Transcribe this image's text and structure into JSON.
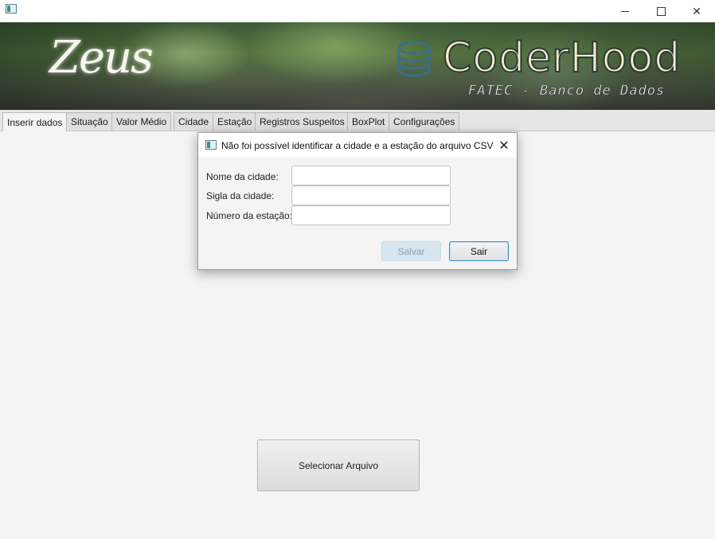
{
  "window": {
    "minimize_label": "—",
    "maximize_label": "☐",
    "close_label": "✕"
  },
  "banner": {
    "left_logo_text": "Zeus",
    "brand_name": "CoderHood",
    "brand_subtitle": "FATEC - Banco de Dados",
    "brand_icon": "database-icon"
  },
  "tabs": [
    {
      "label": "Inserir dados",
      "active": true
    },
    {
      "label": "Situação"
    },
    {
      "label": "Valor Médio"
    },
    {
      "label": "Cidade"
    },
    {
      "label": "Estação"
    },
    {
      "label": "Registros Suspeitos"
    },
    {
      "label": "BoxPlot"
    },
    {
      "label": "Configurações"
    }
  ],
  "main": {
    "select_file_label": "Selecionar Arquivo"
  },
  "dialog": {
    "title": "Não foi possível identificar a cidade e a estação do arquivo CSV",
    "close_label": "✕",
    "fields": [
      {
        "label": "Nome da cidade:",
        "value": ""
      },
      {
        "label": "Sigla da cidade:",
        "value": ""
      },
      {
        "label": "Número da estação:",
        "value": ""
      }
    ],
    "save_label": "Salvar",
    "exit_label": "Sair"
  }
}
